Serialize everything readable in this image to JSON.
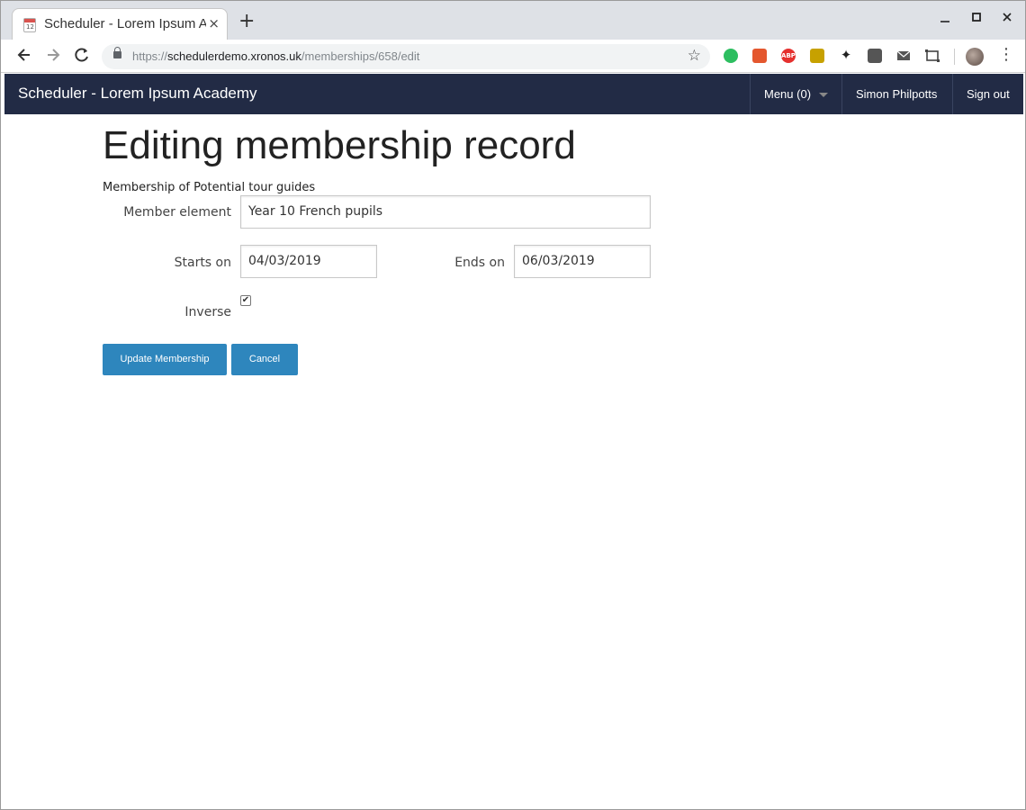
{
  "browser": {
    "tab_title": "Scheduler - Lorem Ipsum Academy",
    "favicon_text": "12",
    "new_tab": "+",
    "close_tab": "×",
    "url_scheme": "https://",
    "url_host": "schedulerdemo.xronos.uk",
    "url_path": "/memberships/658/edit",
    "extensions": [
      {
        "name": "evernote-icon",
        "color": "#2dbe60",
        "text": ""
      },
      {
        "name": "extension-icon",
        "color": "#e4572e",
        "text": ""
      },
      {
        "name": "adblock-icon",
        "color": "#e5302e",
        "text": "ABP"
      },
      {
        "name": "house-icon",
        "color": "#c7a100",
        "text": ""
      },
      {
        "name": "gnome-icon",
        "color": "#222222",
        "text": ""
      },
      {
        "name": "lock-extension-icon",
        "color": "#555555",
        "text": ""
      },
      {
        "name": "mail-icon",
        "color": "#555555",
        "text": ""
      },
      {
        "name": "screenshot-icon",
        "color": "#555555",
        "text": ""
      }
    ]
  },
  "navbar": {
    "brand": "Scheduler - Lorem Ipsum Academy",
    "menu_label": "Menu (0)",
    "user_name": "Simon Philpotts",
    "sign_out": "Sign out",
    "background": "#222b45"
  },
  "page": {
    "title": "Editing membership record",
    "subtitle": "Membership of Potential tour guides"
  },
  "form": {
    "member_element_label": "Member element",
    "member_element_value": "Year 10 French pupils",
    "starts_on_label": "Starts on",
    "starts_on_value": "04/03/2019",
    "ends_on_label": "Ends on",
    "ends_on_value": "06/03/2019",
    "inverse_label": "Inverse",
    "inverse_checked": true,
    "update_button": "Update Membership",
    "cancel_button": "Cancel",
    "button_color": "#2e86bd"
  }
}
